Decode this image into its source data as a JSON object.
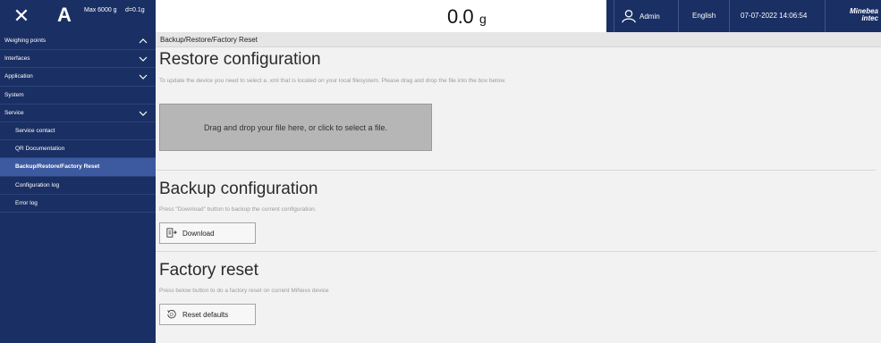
{
  "header": {
    "close_glyph": "✕",
    "scale_letter": "A",
    "max_label": "Max 6000 g",
    "division_label": "d=0.1g",
    "weight_value": "0.0",
    "weight_unit": "g",
    "user_name": "Admin",
    "language": "English",
    "datetime": "07-07-2022 14:06:54",
    "brand_line1": "Minebea",
    "brand_line2": "intec"
  },
  "sidebar": {
    "items": [
      {
        "label": "Weighing points"
      },
      {
        "label": "Interfaces"
      },
      {
        "label": "Application"
      },
      {
        "label": "System"
      },
      {
        "label": "Service"
      },
      {
        "label": "Service contact"
      },
      {
        "label": "QR Documentation"
      },
      {
        "label": "Backup/Restore/Factory Reset"
      },
      {
        "label": "Configuration log"
      },
      {
        "label": "Error log"
      }
    ]
  },
  "breadcrumb": "Backup/Restore/Factory Reset",
  "restore": {
    "title": "Restore configuration",
    "description": "To update the device you need to select a .xml that is located on your local filesystem. Please drag and drop the file into the box below.",
    "dropzone_text": "Drag and drop your file here, or click to select a file."
  },
  "backup": {
    "title": "Backup configuration",
    "description": "Press \"Download\" button to backup the current configuration.",
    "button_label": "Download"
  },
  "factory": {
    "title": "Factory reset",
    "description": "Press below button to do a factory reset on current MiNexx device",
    "button_label": "Reset defaults"
  },
  "colors": {
    "nav_bg": "#1a2f63",
    "nav_active": "#3d5aa0",
    "content_bg": "#f2f2f2",
    "dropzone_bg": "#b6b6b6"
  },
  "icons": {
    "close": "close-icon",
    "user": "user-icon",
    "chevron_up": "chevron-up-icon",
    "chevron_down": "chevron-down-icon",
    "download": "download-icon",
    "reset": "reset-icon"
  }
}
